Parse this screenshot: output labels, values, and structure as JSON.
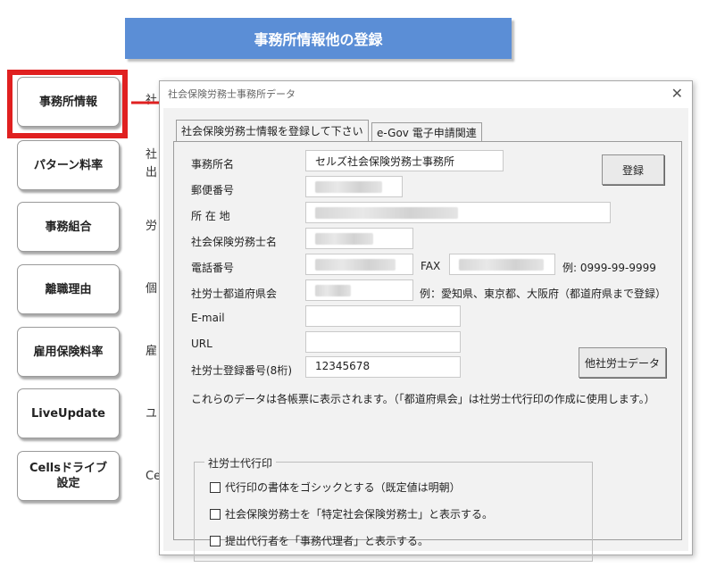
{
  "banner": {
    "title": "事務所情報他の登録"
  },
  "menu": [
    {
      "label": "事務所情報",
      "bg": "社"
    },
    {
      "label": "パターン料率",
      "bg": "社\n出"
    },
    {
      "label": "事務組合",
      "bg": "労"
    },
    {
      "label": "離職理由",
      "bg": "個"
    },
    {
      "label": "雇用保険料率",
      "bg": "雇"
    },
    {
      "label": "LiveUpdate",
      "bg": "ユ"
    },
    {
      "label": "Cellsドライブ\n設定",
      "bg": "Ce"
    }
  ],
  "dialog": {
    "title": "社会保険労務士事務所データ",
    "close": "✕",
    "tabs": [
      "社会保険労務士情報を登録して下さい",
      "e-Gov 電子申請関連"
    ],
    "fields": {
      "office_name_label": "事務所名",
      "office_name_value": "セルズ社会保険労務士事務所",
      "postal_label": "郵便番号",
      "address_label": "所 在 地",
      "sharoushi_name_label": "社会保険労務士名",
      "phone_label": "電話番号",
      "fax_label": "FAX",
      "phone_example": "例:  0999-99-9999",
      "pref_label": "社労士都道府県会",
      "pref_example": "例：愛知県、東京都、大阪府（都道府県まで登録）",
      "email_label": "E-mail",
      "email_value": "",
      "url_label": "URL",
      "url_value": "",
      "reg_no_label": "社労士登録番号(8桁)",
      "reg_no_value": "12345678"
    },
    "buttons": {
      "register": "登録",
      "other_data": "他社労士データ"
    },
    "note": "これらのデータは各帳票に表示されます。（「都道府県会」は社労士代行印の作成に使用します。）",
    "group": {
      "title": "社労士代行印",
      "options": [
        {
          "label": "代行印の書体をゴシックとする（既定値は明朝）",
          "checked": false
        },
        {
          "label": "社会保険労務士を「特定社会保険労務士」と表示する。",
          "checked": false
        },
        {
          "label": "提出代行者を「事務代理者」と表示する。",
          "checked": false
        }
      ]
    }
  },
  "colors": {
    "banner": "#5b8ed6",
    "highlight": "#e02020"
  }
}
